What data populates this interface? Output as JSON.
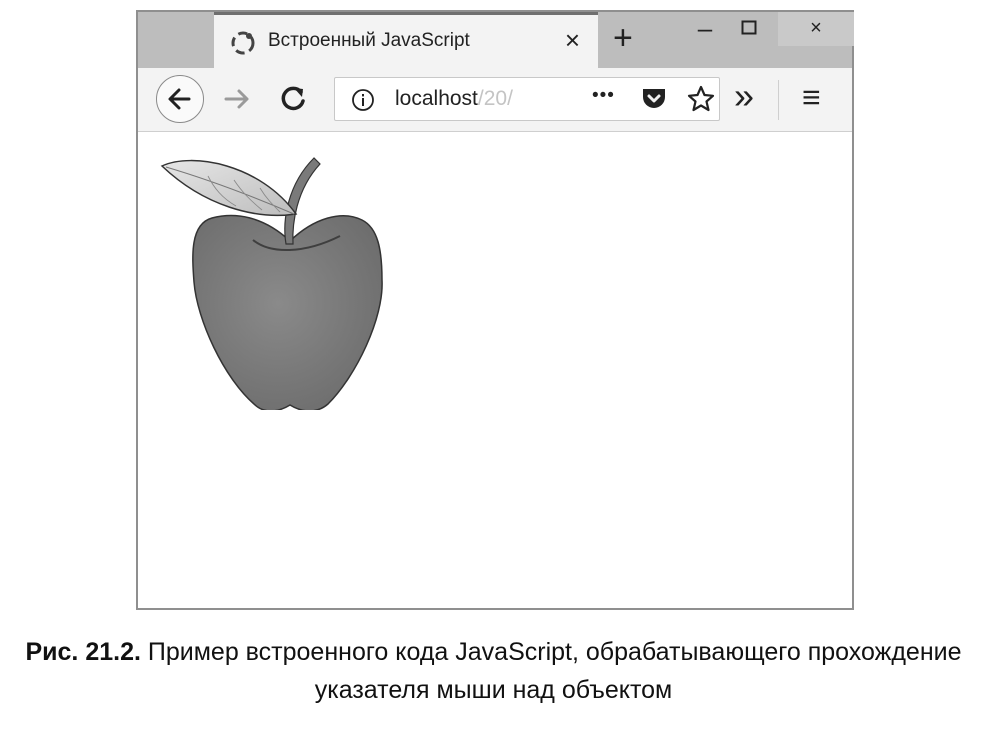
{
  "tab": {
    "title": "Встроенный JavaScript",
    "close_label": "×"
  },
  "window": {
    "new_tab_label": "+",
    "minimize_label": "–",
    "close_label": "×"
  },
  "toolbar": {
    "url_host": "localhost",
    "url_path": "/20/",
    "more_label": "•••",
    "overflow_label": "»",
    "menu_label": "≡"
  },
  "content": {
    "image": "apple-icon"
  },
  "caption": {
    "figure_label": "Рис. 21.2.",
    "text_line1": "Пример встроенного кода JavaScript, обрабатывающего прохождение",
    "text_line2": "указателя мыши над объектом"
  }
}
